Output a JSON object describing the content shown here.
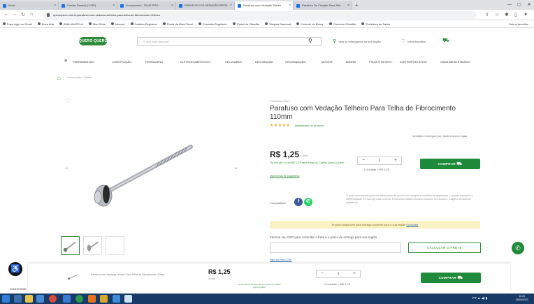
{
  "browser": {
    "tabs": [
      {
        "label": "Inbox"
      },
      {
        "label": "Contas Danads (1.087)"
      },
      {
        "label": "Acompanhar - PLNS PRO"
      },
      {
        "label": "PARAFUSO DE VEDAÇÃO BRITA"
      },
      {
        "label": "Parafuso com Vedação Telheir"
      },
      {
        "label": "Parafuso De Fixação Para Telh"
      }
    ],
    "url": "queroquero.com.br/parafuso-com-vedacao-telheiro-para-telha-de-fibrocimento-110mm",
    "bookmarks": [
      {
        "label": "Faça login no Gmail"
      },
      {
        "label": "Novo Aba"
      },
      {
        "label": "AVALUNATELA"
      },
      {
        "label": "Meu Drive"
      },
      {
        "label": "Internet"
      },
      {
        "label": "Carteira Registros"
      },
      {
        "label": "Portal da Nota Fiscal"
      },
      {
        "label": "Consulta Regularid."
      },
      {
        "label": "Portal do Cidadão"
      },
      {
        "label": "Simples Nacional"
      },
      {
        "label": "Controle de Estoq."
      },
      {
        "label": "Conector Cidadão"
      },
      {
        "label": "Prefeitura de Santa"
      }
    ],
    "bookmarks_more": "Outros favoritos"
  },
  "header": {
    "logo": "QUERO·QUERO",
    "search_placeholder": "O que você procura?",
    "delivery_link": "Veja se entregamos na sua região",
    "favorites_link": "Meus favoritos"
  },
  "categories": [
    "Ferramentas",
    "Construção",
    "Ferragens",
    "Eletrodomésticos",
    "Celulares",
    "Decoração",
    "Organização",
    "Móveis",
    "Jardim",
    "Pisos e Revest.",
    "Eletroportáteis",
    "Cama Mesa e Banho"
  ],
  "breadcrumb": "Construção  /  Telhas",
  "product": {
    "brand": "Parafusos Ciser",
    "title": "Parafuso com Vedação Telheiro Para Telha de Fibrocimento 110mm",
    "stars": "★★★★★",
    "reviews": "(avaliações do produto)",
    "sold_by": "Vendido e entregue por: Quero-Quero Lojas",
    "price": "R$ 1,25",
    "price_unit": "a vista",
    "pix_note": "Ou em até 1x de R$ 1,25 sem juros no Cartão Quero-Quero",
    "installments": "Mais formas de pagamento",
    "qty": "1",
    "unit_label": "1 Unidade = R$ 1,25",
    "buy_label": "COMPRAR",
    "share_label": "Compartilhar",
    "info_text": "O preço mencionado pode ser diferenciado de acordo com a região e condição de pagamento. Consulte condições e disponibilidade em sua loja mais próxima. Promoções válidas enquanto durarem os estoques. Imagens meramente ilustrativas.",
    "notice": "Produto disponível para entrega somente para a sua região",
    "notice_link": "Consultar"
  },
  "shipping": {
    "label": "Informe seu CEP para consultar o frete e o prazo de entrega para sua região",
    "button": "CALCULAR O FRETE",
    "link": "Não sei meu CEP"
  },
  "sticky": {
    "name": "Parafuso com Vedação Telheiro Para Telha de Fibrocimento 110mm",
    "price": "R$ 1,25",
    "unit": "à vista",
    "pix": "Ou em até 1x de R$ 1,25 sem juros no Cartão Quero-Quero",
    "qty": "1",
    "unit_label": "1 Unidade = R$ 1,25",
    "buy_label": "COMPRAR"
  },
  "accessibility_label": "CONFIGURAR",
  "taskbar": {
    "tray": "PT  ▲  ◀)  ▮",
    "time": "15:23",
    "date": "06/04/2023"
  },
  "colors": {
    "brand_green": "#1f8a3a",
    "notice_bg": "#fbf2c4"
  }
}
